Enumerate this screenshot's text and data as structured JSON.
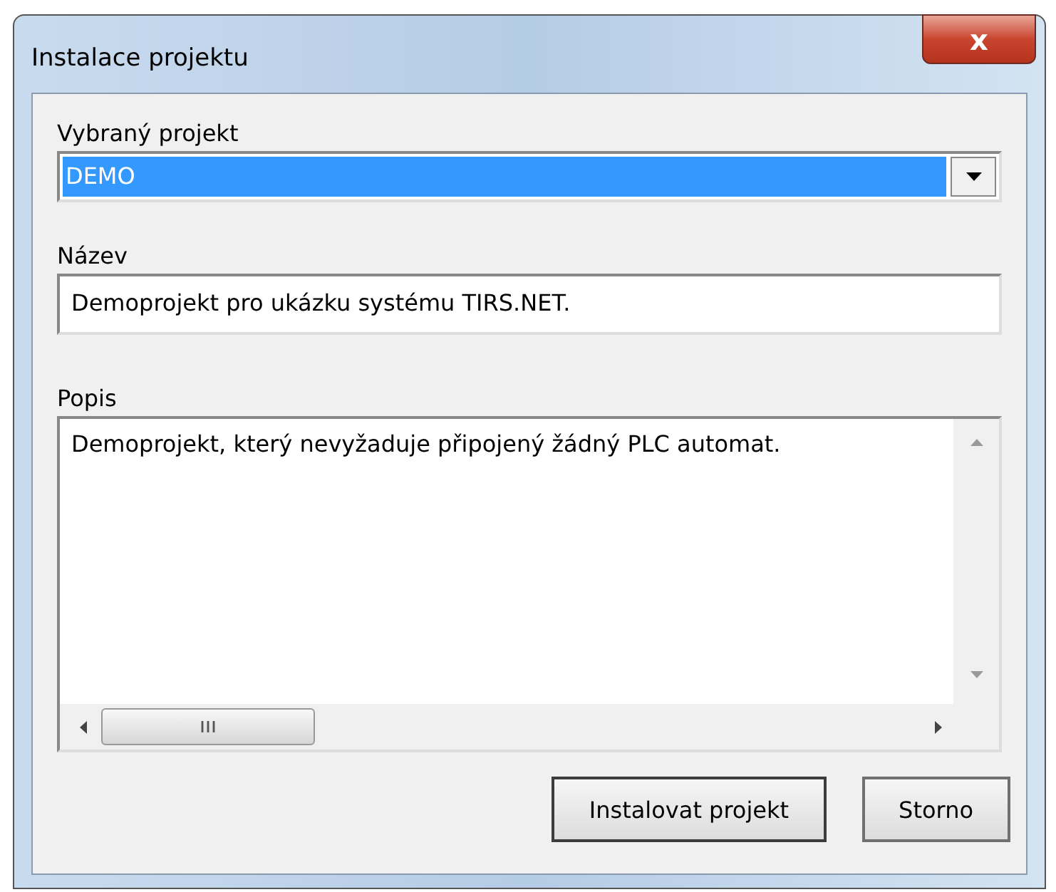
{
  "window": {
    "title": "Instalace projektu",
    "close_button": "x"
  },
  "project": {
    "label": "Vybraný projekt",
    "value": "DEMO",
    "highlighted": true
  },
  "name": {
    "label": "Název",
    "value": "Demoprojekt pro ukázku systému TIRS.NET."
  },
  "description": {
    "label": "Popis",
    "value": "Demoprojekt, který nevyžaduje připojený žádný PLC automat."
  },
  "buttons": [
    {
      "label": "Instalovat projekt",
      "default": true
    },
    {
      "label": "Storno",
      "default": false
    }
  ]
}
